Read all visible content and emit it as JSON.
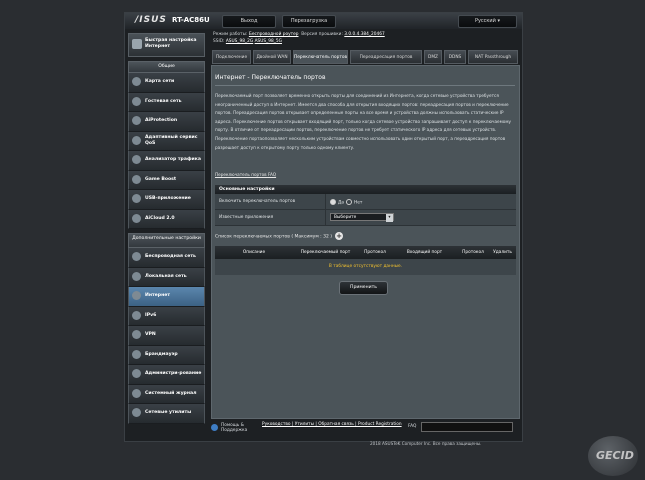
{
  "header": {
    "logo": "/ISUS",
    "model": "RT-AC86U",
    "logout": "Выход",
    "reboot": "Перезагрузка",
    "language": "Русский"
  },
  "status": {
    "mode_label": "Режим работы:",
    "mode_value": "Беспроводной роутер",
    "firmware_label": "Версия прошивки:",
    "firmware_value": "3.0.0.4.384_20467",
    "ssid_label": "SSID:",
    "ssid1": "ASUS_98_2G",
    "ssid2": "ASUS_98_5G"
  },
  "sidebar": {
    "quick_setup": "Быстрая настройка Интернет",
    "group_general": "Общие",
    "general": [
      {
        "label": "Карта сети"
      },
      {
        "label": "Гостевая сеть"
      },
      {
        "label": "AiProtection"
      },
      {
        "label": "Адаптивный сервис QoS"
      },
      {
        "label": "Анализатор трафика"
      },
      {
        "label": "Game Boost"
      },
      {
        "label": "USB-приложение"
      },
      {
        "label": "AiCloud 2.0"
      }
    ],
    "group_advanced": "Дополнительные настройки",
    "advanced": [
      {
        "label": "Беспроводная сеть"
      },
      {
        "label": "Локальная сеть"
      },
      {
        "label": "Интернет"
      },
      {
        "label": "IPv6"
      },
      {
        "label": "VPN"
      },
      {
        "label": "Брандмауэр"
      },
      {
        "label": "Администри-рование"
      },
      {
        "label": "Системный журнал"
      },
      {
        "label": "Сетевые утилиты"
      }
    ]
  },
  "tabs": [
    "Подключение",
    "Двойной WAN",
    "Переключатель портов",
    "Переадресация портов",
    "DMZ",
    "DDNS",
    "NAT Passthrough"
  ],
  "content": {
    "title": "Интернет - Переключатель портов",
    "description": "Переключаемый порт позволяет временно открыть порты для соединений из Интернета, когда сетевые устройства требуется неограниченный доступ в Интернет. Имеется два способа для открытия входящих портов: переадресация портов и переключение портов. Переадресация портов открывает определенные порты на все время и устройства должны использовать статические IP адреса. Переключение портов открывает входящий порт, только когда сетевое устройство запрашивает доступ к переключаемому порту. В отличие от переадресации портов, переключение портов не требует статического IP адреса для сетевых устройств. Переключение портаопозволяет нескольким устройствам совместно использовать один открытый порт, а переадресация портов разрешает доступ к открытому порту только одному клиенту.",
    "faq_link": "Переключатель портов FAQ",
    "basic_title": "Основные настройки",
    "enable_label": "Включить переключатель портов",
    "yes": "Да",
    "no": "Нет",
    "known_apps_label": "Известные приложения",
    "select_value": "Выберите",
    "list_title": "Список переключаемых портов ( Максимум : 32 )",
    "columns": [
      "Описание",
      "Переключаемый порт",
      "Протокол",
      "Входящий порт",
      "Протокол",
      "Удалить"
    ],
    "empty_text": "В таблице отсутствуют данные.",
    "apply": "Применить"
  },
  "footer": {
    "help": "Помощь & Поддержка",
    "links": "Руководство | Утилиты | Обратная связь | Product Registration",
    "faq": "FAQ",
    "copyright": "2018 ASUSTeK Computer Inc. Все права защищены."
  },
  "watermark": {
    "text": "GECID"
  },
  "colors": {
    "active_tab": "#4a5258",
    "active_item": "#4f7aa2",
    "empty_text": "#f2c12e"
  }
}
